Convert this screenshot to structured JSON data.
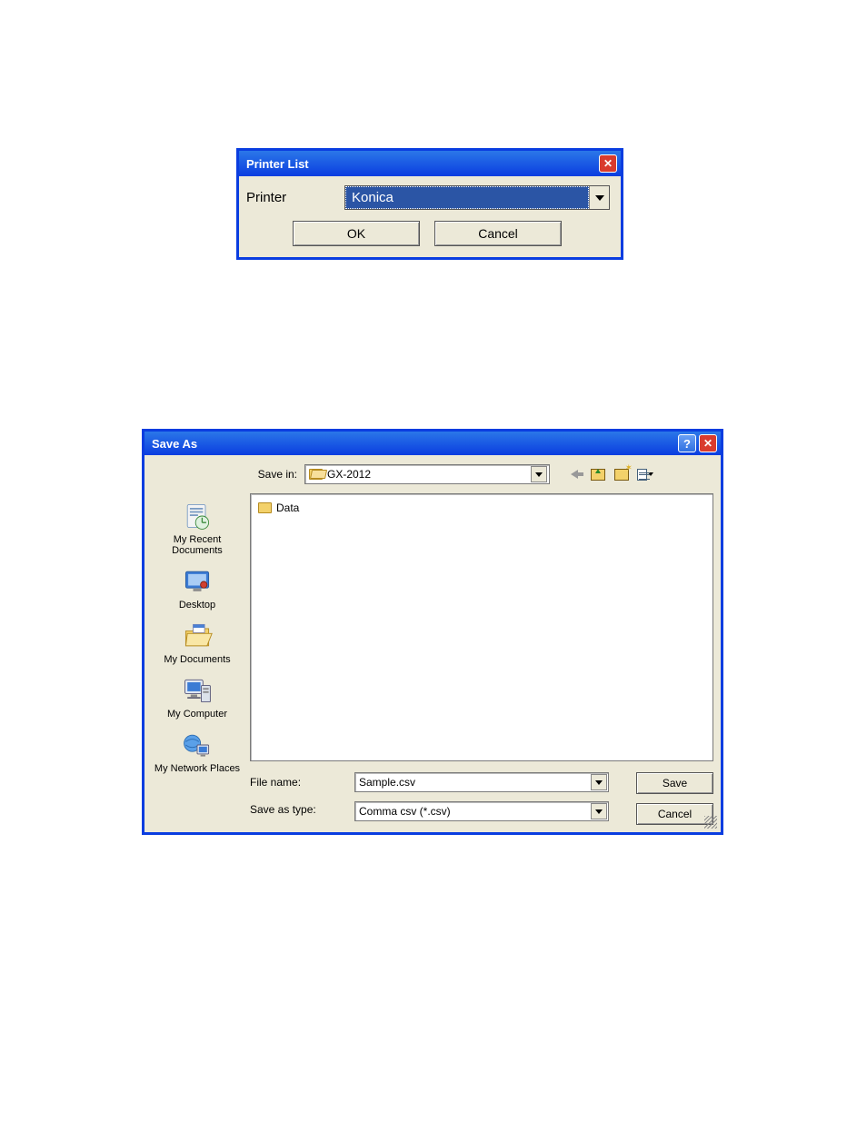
{
  "printer_dialog": {
    "title": "Printer List",
    "label": "Printer",
    "selected": "Konica",
    "ok": "OK",
    "cancel": "Cancel"
  },
  "saveas_dialog": {
    "title": "Save As",
    "savein_label": "Save in:",
    "savein_value": "GX-2012",
    "file_items": [
      "Data"
    ],
    "sidebar": [
      "My Recent Documents",
      "Desktop",
      "My Documents",
      "My Computer",
      "My Network Places"
    ],
    "filename_label": "File name:",
    "filename_value": "Sample.csv",
    "savetype_label": "Save as type:",
    "savetype_value": "Comma csv (*.csv)",
    "save": "Save",
    "cancel": "Cancel"
  }
}
